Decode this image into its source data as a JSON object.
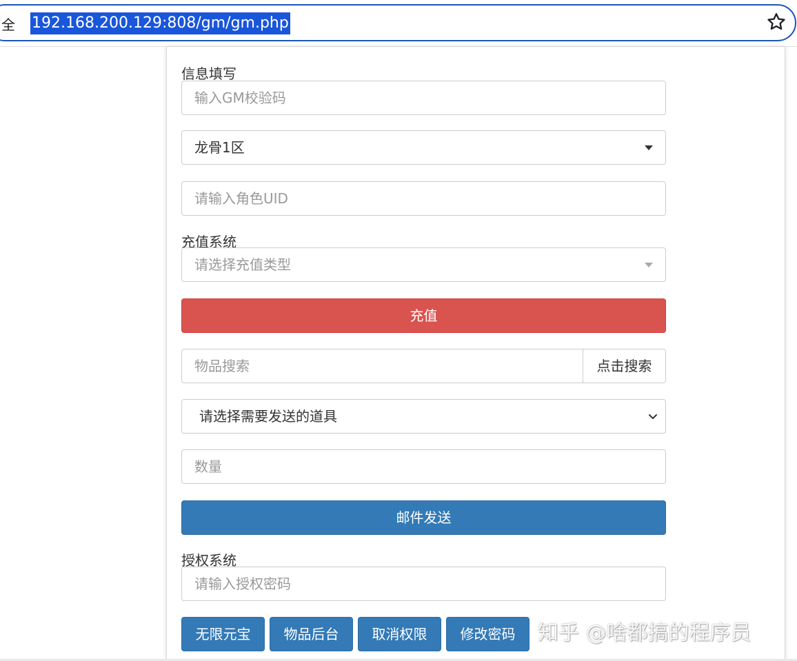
{
  "browser": {
    "security_label": "全",
    "url": "192.168.200.129:808/gm/gm.php"
  },
  "info_section": {
    "label": "信息填写",
    "gm_code_placeholder": "输入GM校验码",
    "server_selected": "龙骨1区",
    "uid_placeholder": "请输入角色UID"
  },
  "recharge_section": {
    "label": "充值系统",
    "type_placeholder": "请选择充值类型",
    "recharge_button": "充值"
  },
  "item_section": {
    "search_placeholder": "物品搜索",
    "search_button": "点击搜索",
    "item_select": "请选择需要发送的道具",
    "quantity_placeholder": "数量",
    "send_button": "邮件发送"
  },
  "auth_section": {
    "label": "授权系统",
    "password_placeholder": "请输入授权密码",
    "buttons": [
      "无限元宝",
      "物品后台",
      "取消权限",
      "修改密码"
    ]
  },
  "watermark": "知乎 @啥都搞的程序员",
  "colors": {
    "danger": "#d9534f",
    "primary": "#337ab7",
    "url_highlight": "#1a56d9"
  }
}
